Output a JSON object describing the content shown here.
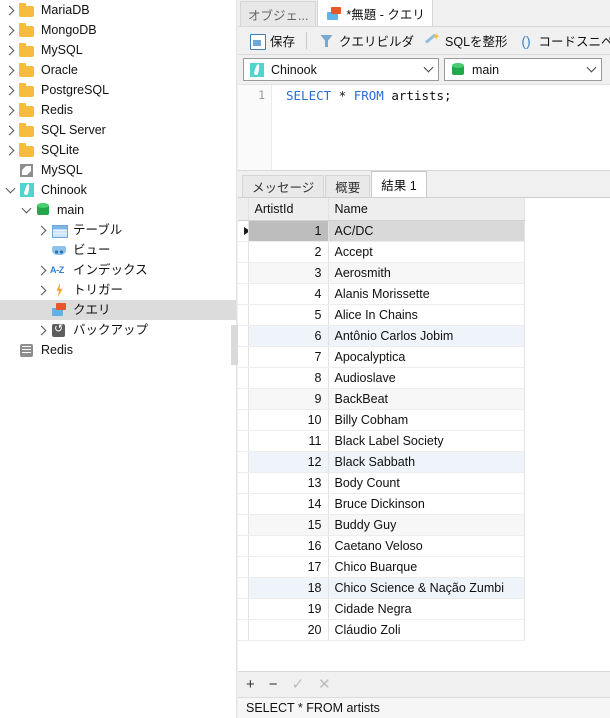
{
  "sidebar": {
    "items": [
      {
        "label": "MariaDB",
        "icon": "folder-icon",
        "indent": 0,
        "twisty": "right",
        "selected": false
      },
      {
        "label": "MongoDB",
        "icon": "folder-icon",
        "indent": 0,
        "twisty": "right",
        "selected": false
      },
      {
        "label": "MySQL",
        "icon": "folder-icon",
        "indent": 0,
        "twisty": "right",
        "selected": false
      },
      {
        "label": "Oracle",
        "icon": "folder-icon",
        "indent": 0,
        "twisty": "right",
        "selected": false
      },
      {
        "label": "PostgreSQL",
        "icon": "folder-icon",
        "indent": 0,
        "twisty": "right",
        "selected": false
      },
      {
        "label": "Redis",
        "icon": "folder-icon",
        "indent": 0,
        "twisty": "right",
        "selected": false
      },
      {
        "label": "SQL Server",
        "icon": "folder-icon",
        "indent": 0,
        "twisty": "right",
        "selected": false
      },
      {
        "label": "SQLite",
        "icon": "folder-icon",
        "indent": 0,
        "twisty": "right",
        "selected": false
      },
      {
        "label": "MySQL",
        "icon": "mysql-dolphin-icon",
        "indent": 0,
        "twisty": "none",
        "selected": false
      },
      {
        "label": "Chinook",
        "icon": "sqlite-feather-icon",
        "indent": 0,
        "twisty": "down",
        "selected": false
      },
      {
        "label": "main",
        "icon": "database-icon",
        "indent": 1,
        "twisty": "down",
        "selected": false
      },
      {
        "label": "テーブル",
        "icon": "table-icon",
        "indent": 2,
        "twisty": "right",
        "selected": false
      },
      {
        "label": "ビュー",
        "icon": "view-icon",
        "indent": 2,
        "twisty": "none",
        "selected": false
      },
      {
        "label": "インデックス",
        "icon": "index-az-icon",
        "indent": 2,
        "twisty": "right",
        "selected": false
      },
      {
        "label": "トリガー",
        "icon": "trigger-bolt-icon",
        "indent": 2,
        "twisty": "right",
        "selected": false
      },
      {
        "label": "クエリ",
        "icon": "query-icon",
        "indent": 2,
        "twisty": "none",
        "selected": true
      },
      {
        "label": "バックアップ",
        "icon": "backup-icon",
        "indent": 2,
        "twisty": "right",
        "selected": false
      },
      {
        "label": "Redis",
        "icon": "redis-icon",
        "indent": 0,
        "twisty": "none",
        "selected": false
      }
    ]
  },
  "tabs": [
    {
      "label": "オブジェ...",
      "icon": "none",
      "active": false
    },
    {
      "label": "*無題 - クエリ",
      "icon": "query-icon",
      "active": true
    }
  ],
  "toolbar": {
    "save_label": "保存",
    "query_builder_label": "クエリビルダ",
    "format_sql_label": "SQLを整形",
    "code_snippet_label": "コードスニペ"
  },
  "connection": {
    "connection_value": "Chinook",
    "database_value": "main"
  },
  "editor": {
    "line_number": "1",
    "keyword1": "SELECT",
    "star": " * ",
    "keyword2": "FROM",
    "table": " artists;"
  },
  "result_tabs": [
    {
      "label": "メッセージ",
      "active": false
    },
    {
      "label": "概要",
      "active": false
    },
    {
      "label": "結果 1",
      "active": true
    }
  ],
  "grid": {
    "columns": [
      "ArtistId",
      "Name"
    ],
    "rows": [
      {
        "id": "1",
        "name": "AC/DC"
      },
      {
        "id": "2",
        "name": "Accept"
      },
      {
        "id": "3",
        "name": "Aerosmith"
      },
      {
        "id": "4",
        "name": "Alanis Morissette"
      },
      {
        "id": "5",
        "name": "Alice In Chains"
      },
      {
        "id": "6",
        "name": "Antônio Carlos Jobim"
      },
      {
        "id": "7",
        "name": "Apocalyptica"
      },
      {
        "id": "8",
        "name": "Audioslave"
      },
      {
        "id": "9",
        "name": "BackBeat"
      },
      {
        "id": "10",
        "name": "Billy Cobham"
      },
      {
        "id": "11",
        "name": "Black Label Society"
      },
      {
        "id": "12",
        "name": "Black Sabbath"
      },
      {
        "id": "13",
        "name": "Body Count"
      },
      {
        "id": "14",
        "name": "Bruce Dickinson"
      },
      {
        "id": "15",
        "name": "Buddy Guy"
      },
      {
        "id": "16",
        "name": "Caetano Veloso"
      },
      {
        "id": "17",
        "name": "Chico Buarque"
      },
      {
        "id": "18",
        "name": "Chico Science & Nação Zumbi"
      },
      {
        "id": "19",
        "name": "Cidade Negra"
      },
      {
        "id": "20",
        "name": "Cláudio Zoli"
      }
    ],
    "selected_row_index": 0
  },
  "grid_tools": {
    "add": "+",
    "remove": "−",
    "confirm": "✓",
    "cancel": "✕"
  },
  "status": {
    "text": "SELECT * FROM artists"
  },
  "colors": {
    "accent_blue": "#2a6fd8",
    "folder_yellow": "#f7bc3e",
    "db_green": "#21a84a",
    "sqlite_teal": "#4fd5cd",
    "selection_gray": "#dcdcdc",
    "stripe_blue": "#eff4fa"
  }
}
